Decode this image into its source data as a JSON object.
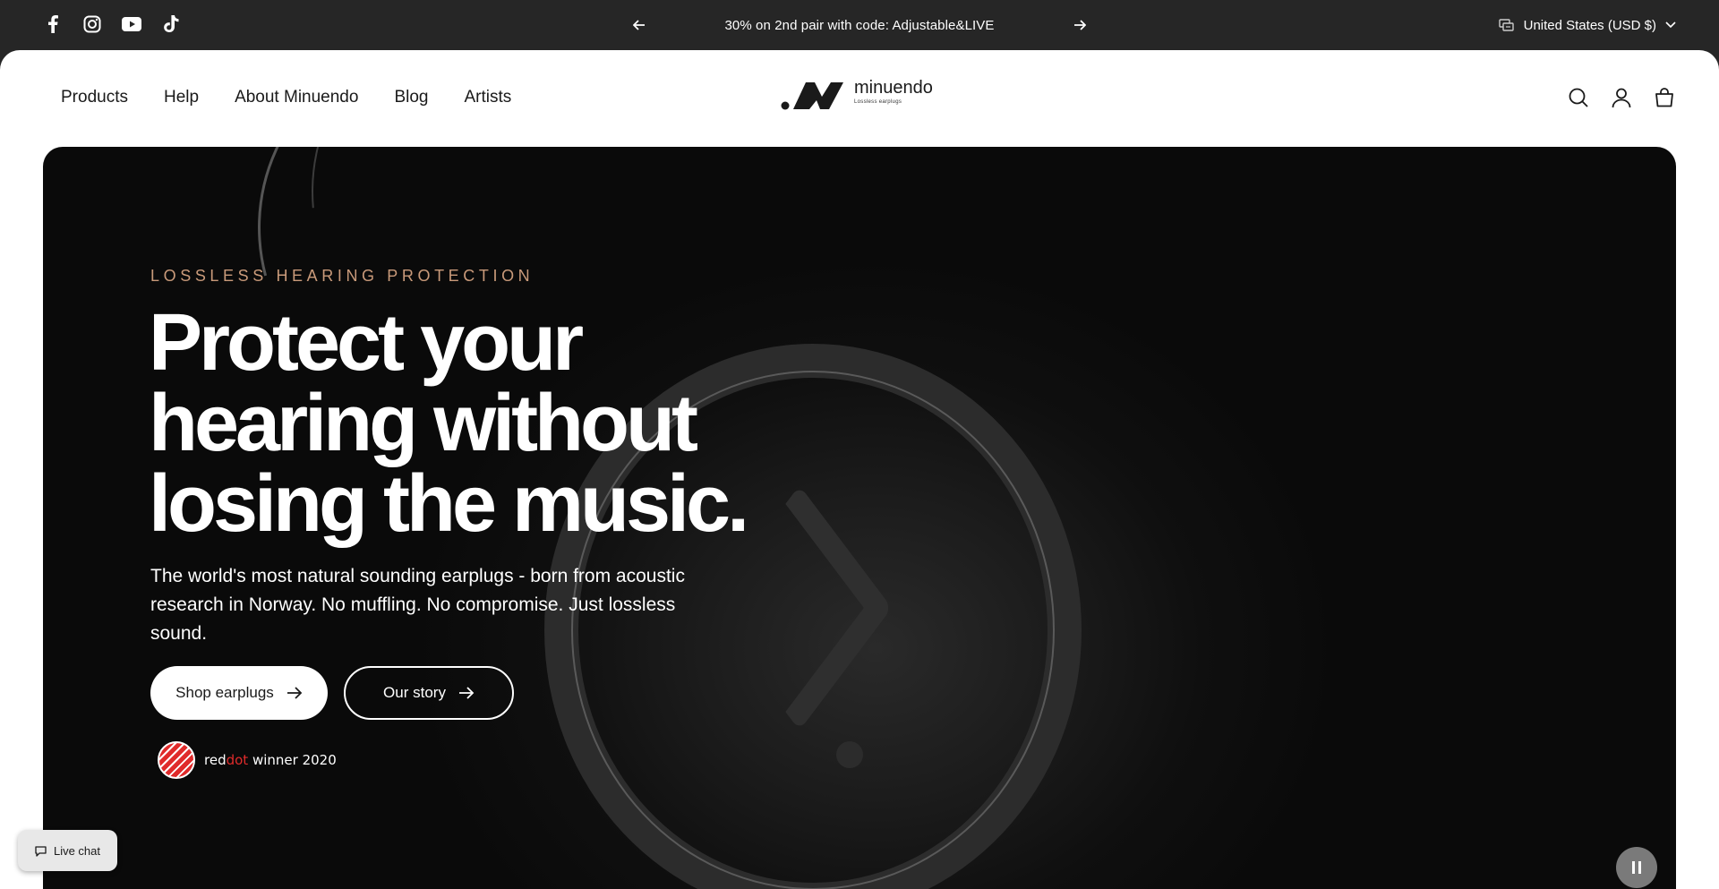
{
  "topbar": {
    "social": [
      {
        "icon": "facebook-icon"
      },
      {
        "icon": "instagram-icon"
      },
      {
        "icon": "youtube-icon"
      },
      {
        "icon": "tiktok-icon"
      }
    ],
    "announcement": "30% on 2nd pair with code: Adjustable&LIVE",
    "currency": "United States (USD $)"
  },
  "nav": {
    "items": [
      "Products",
      "Help",
      "About Minuendo",
      "Blog",
      "Artists"
    ]
  },
  "logo": {
    "wordmark": "minuendo",
    "tagline": "Lossless earplugs"
  },
  "hero": {
    "eyebrow": "LOSSLESS HEARING PROTECTION",
    "headline": "Protect your hearing without losing the music.",
    "subtext": "The world's most natural sounding earplugs - born from acoustic research in Norway. No muffling. No compromise. Just lossless sound.",
    "primary_button": "Shop earplugs",
    "secondary_button": "Our story",
    "award_red": "red",
    "award_dot": "dot",
    "award_suffix": " winner 2020"
  },
  "livechat": {
    "label": "Live chat"
  },
  "colors": {
    "accent": "#c99a7a",
    "dark": "#262626",
    "reddot": "#e02b2b"
  }
}
